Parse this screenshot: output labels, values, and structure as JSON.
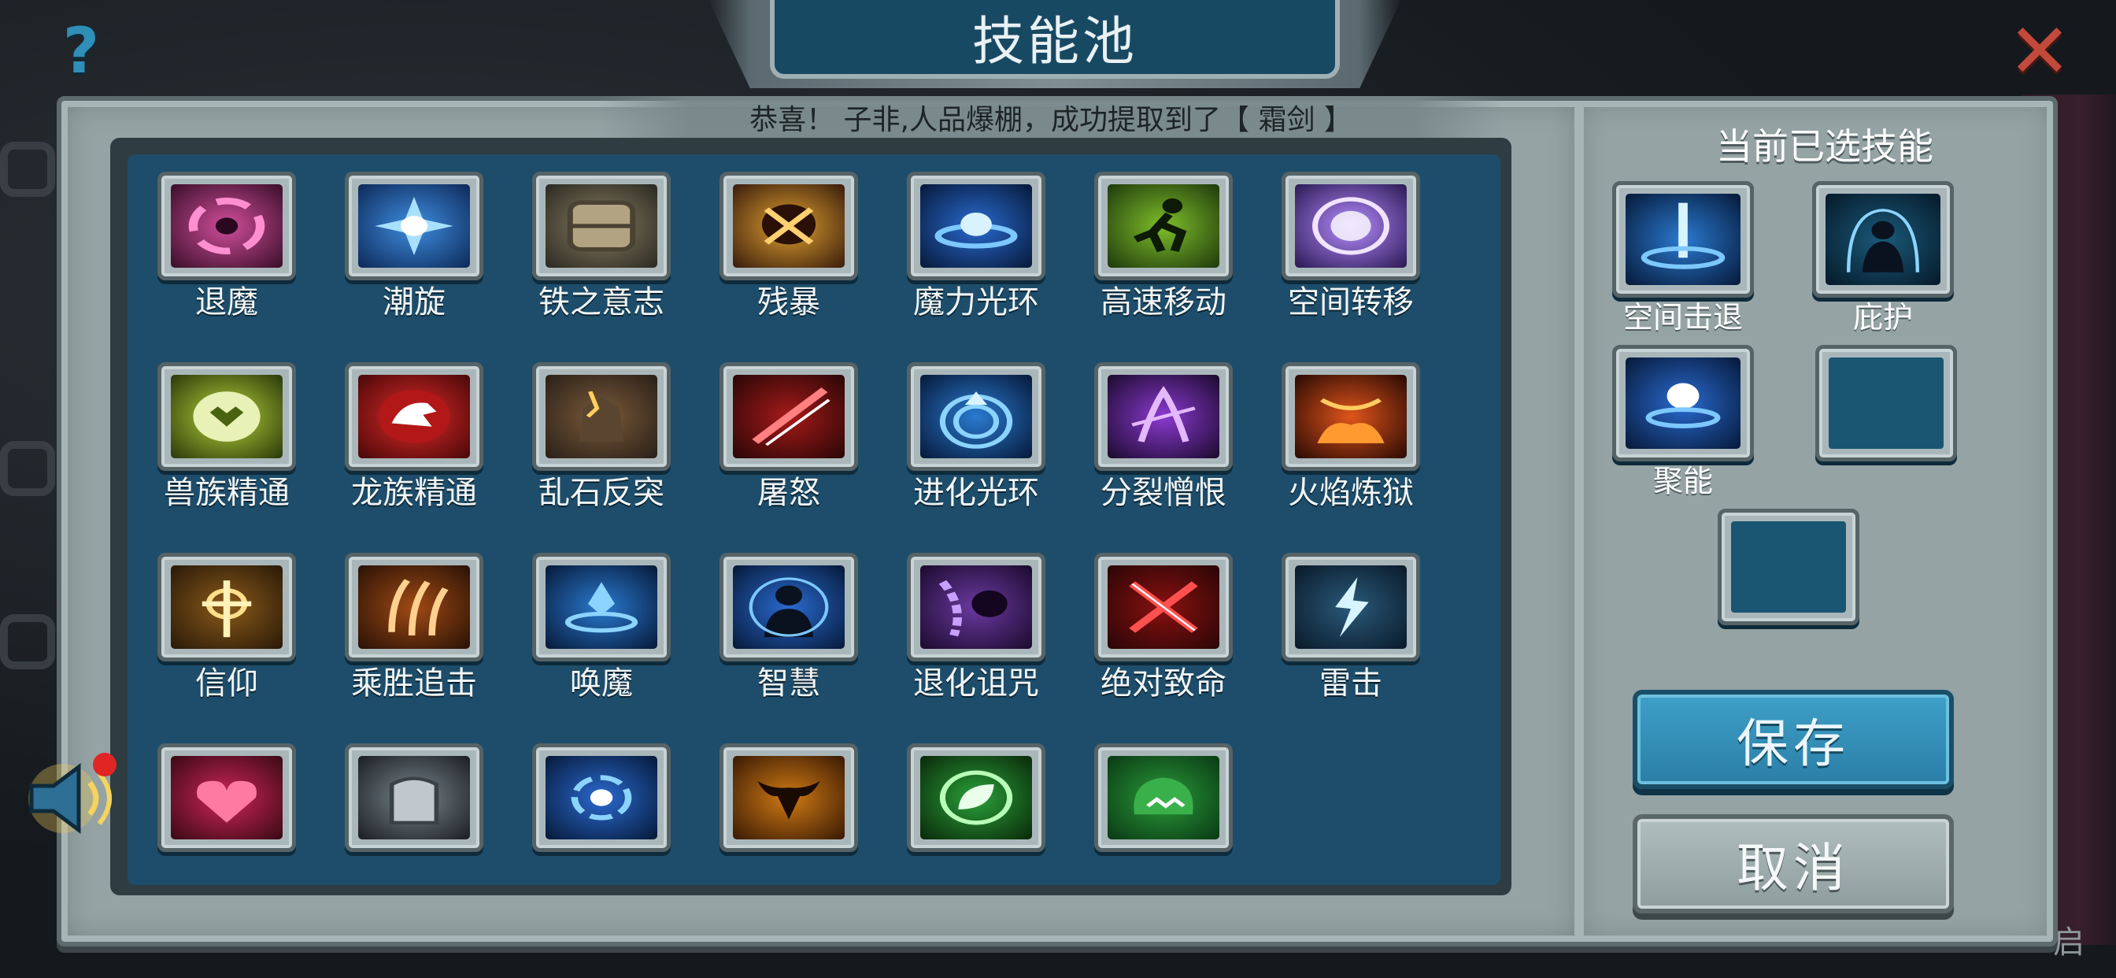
{
  "title": "技能池",
  "notice": "恭喜！ 子非,人品爆棚，成功提取到了【 霜剑 】",
  "selected_title": "当前已选技能",
  "buttons": {
    "save": "保存",
    "cancel": "取消"
  },
  "corner_text": "启",
  "colors": {
    "panel": "#1d4d6a",
    "stone": "#95a3a5",
    "accent": "#3ea0c8",
    "close": "#c24a3c"
  },
  "skills": [
    {
      "label": "退魔",
      "icon": "pink-vortex-icon"
    },
    {
      "label": "潮旋",
      "icon": "blue-swirl-icon"
    },
    {
      "label": "铁之意志",
      "icon": "iron-armor-icon"
    },
    {
      "label": "残暴",
      "icon": "brutal-fist-icon"
    },
    {
      "label": "魔力光环",
      "icon": "mana-aura-icon"
    },
    {
      "label": "高速移动",
      "icon": "sprint-icon"
    },
    {
      "label": "空间转移",
      "icon": "space-warp-icon"
    },
    {
      "label": "兽族精通",
      "icon": "beast-emblem-icon"
    },
    {
      "label": "龙族精通",
      "icon": "dragon-emblem-icon"
    },
    {
      "label": "乱石反突",
      "icon": "rock-golem-icon"
    },
    {
      "label": "屠怒",
      "icon": "red-slash-icon"
    },
    {
      "label": "进化光环",
      "icon": "evolve-rings-icon"
    },
    {
      "label": "分裂憎恨",
      "icon": "split-hatred-icon"
    },
    {
      "label": "火焰炼狱",
      "icon": "flame-inferno-icon"
    },
    {
      "label": "信仰",
      "icon": "holy-cross-icon"
    },
    {
      "label": "乘胜追击",
      "icon": "claw-strike-icon"
    },
    {
      "label": "唤魔",
      "icon": "summon-crystal-icon"
    },
    {
      "label": "智慧",
      "icon": "wisdom-figure-icon"
    },
    {
      "label": "退化诅咒",
      "icon": "chain-curse-icon"
    },
    {
      "label": "绝对致命",
      "icon": "lethal-cross-icon"
    },
    {
      "label": "雷击",
      "icon": "lightning-icon"
    },
    {
      "label": "",
      "icon": "red-lightning-heart-icon"
    },
    {
      "label": "",
      "icon": "steel-gauntlet-icon"
    },
    {
      "label": "",
      "icon": "blue-orb-swirl-icon"
    },
    {
      "label": "",
      "icon": "bull-skull-icon"
    },
    {
      "label": "",
      "icon": "green-leaf-icon"
    },
    {
      "label": "",
      "icon": "green-beast-icon"
    }
  ],
  "selected": [
    {
      "label": "空间击退",
      "icon": "space-knockback-icon"
    },
    {
      "label": "庇护",
      "icon": "sanctuary-icon"
    },
    {
      "label": "聚能",
      "icon": "energy-gather-icon"
    },
    {
      "label": "",
      "icon": ""
    },
    {
      "label": "",
      "icon": ""
    }
  ]
}
